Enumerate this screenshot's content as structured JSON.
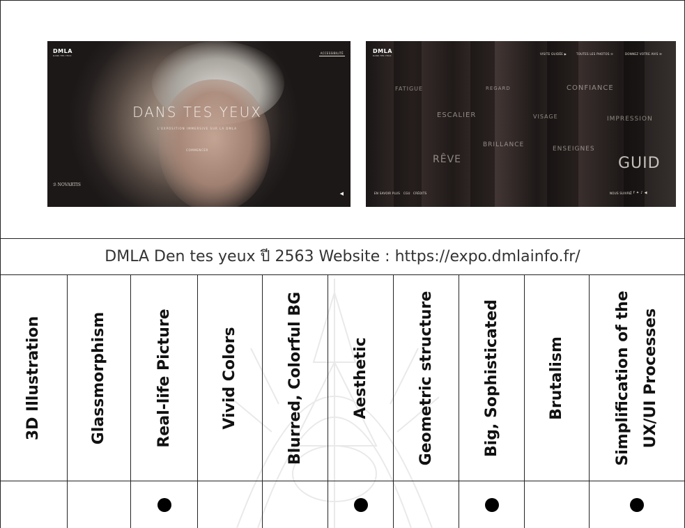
{
  "screenshots": [
    {
      "brand": "DMLA",
      "brand_sub": "DANS TES YEUX",
      "accessibility_button": "ACCESSIBILITÉ",
      "hero_title": "DANS TES YEUX",
      "hero_subtitle": "L'EXPOSITION IMMERSIVE SUR LA DMLA",
      "cta": "COMMENCER",
      "sponsor": "NOVARTIS",
      "sound_icon": "speaker-icon"
    },
    {
      "brand": "DMLA",
      "brand_sub": "DANS TES YEUX",
      "nav_items": [
        "VISITE GUIDÉE ▶",
        "TOUTES LES PHOTOS ☷",
        "DONNEZ VOTRE AVIS ✉"
      ],
      "words": [
        "FATIGUE",
        "REGARD",
        "CONFIANCE",
        "ESCALIER",
        "VISAGE",
        "IMPRESSION",
        "BRILLANCE",
        "ENSEIGNES",
        "RÊVE",
        "GUID"
      ],
      "footer_left": [
        "EN SAVOIR PLUS",
        "CGU",
        "CRÉDITS"
      ],
      "footer_right": "NOUS SUIVRE"
    }
  ],
  "caption": "DMLA Den tes yeux ปี 2563 Website : https://expo.dmlainfo.fr/",
  "columns": [
    {
      "label": "3D Illustration",
      "checked": false
    },
    {
      "label": "Glassmorphism",
      "checked": false
    },
    {
      "label": "Real-life Picture",
      "checked": true
    },
    {
      "label": "Vivid Colors",
      "checked": false
    },
    {
      "label": "Blurred, Colorful BG",
      "checked": false
    },
    {
      "label": "Aesthetic",
      "checked": true
    },
    {
      "label": "Geometric structure",
      "checked": false
    },
    {
      "label": "Big, Sophisticated",
      "checked": true
    },
    {
      "label": "Brutalism",
      "checked": false
    },
    {
      "label": "Simplification of the UX/UI Processes",
      "checked": true
    }
  ],
  "colors": {
    "border": "#222222",
    "dot": "#000000",
    "text": "#111111"
  }
}
